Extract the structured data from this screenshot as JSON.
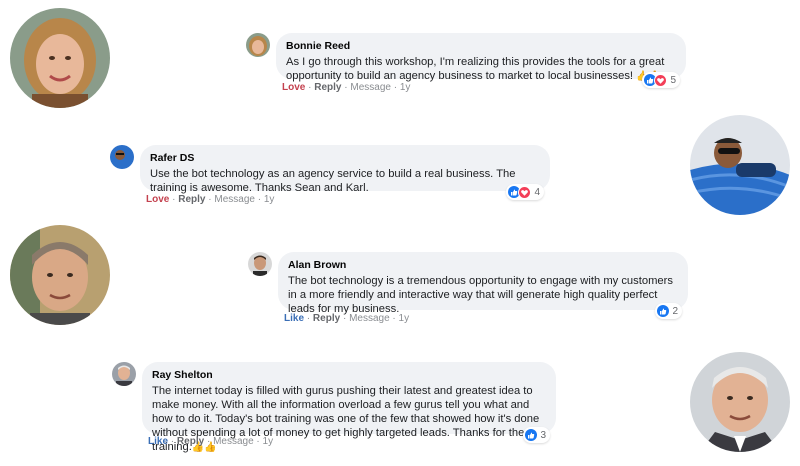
{
  "comments": [
    {
      "author": "Bonnie Reed",
      "text": "As I go through this workshop, I'm realizing this provides the tools for a great opportunity to build an agency business to market to local businesses!",
      "emoji": "👍🙏",
      "reaction_count": "5",
      "reactions": [
        "like",
        "love"
      ],
      "action": "Love",
      "reply": "Reply",
      "message": "Message",
      "time": "1y"
    },
    {
      "author": "Rafer DS",
      "text": "Use the bot technology as an agency service to build a real business. The training is awesome. Thanks Sean and Karl.",
      "emoji": "",
      "reaction_count": "4",
      "reactions": [
        "like",
        "love"
      ],
      "action": "Love",
      "reply": "Reply",
      "message": "Message",
      "time": "1y"
    },
    {
      "author": "Alan Brown",
      "text": "The bot technology is a tremendous opportunity to engage with my customers in a more friendly and interactive way that will generate high quality perfect leads for my business.",
      "emoji": "",
      "reaction_count": "2",
      "reactions": [
        "like"
      ],
      "action": "Like",
      "reply": "Reply",
      "message": "Message",
      "time": "1y"
    },
    {
      "author": "Ray Shelton",
      "text": "The internet today is filled with gurus pushing their latest and greatest idea to make money. With all the information overload a few gurus tell you what and how to do it. Today's bot training was one of the few that showed how it's done without spending a lot of money to get highly targeted leads. Thanks for the training.",
      "emoji": "👍👍",
      "reaction_count": "3",
      "reactions": [
        "like"
      ],
      "action": "Like",
      "reply": "Reply",
      "message": "Message",
      "time": "1y"
    }
  ],
  "separator": "·",
  "colors": {
    "bubble": "#f0f2f5",
    "like_blue": "#1877f2",
    "love_red": "#f33e58",
    "love_action": "#c4424f",
    "like_action": "#3b6fb6"
  }
}
